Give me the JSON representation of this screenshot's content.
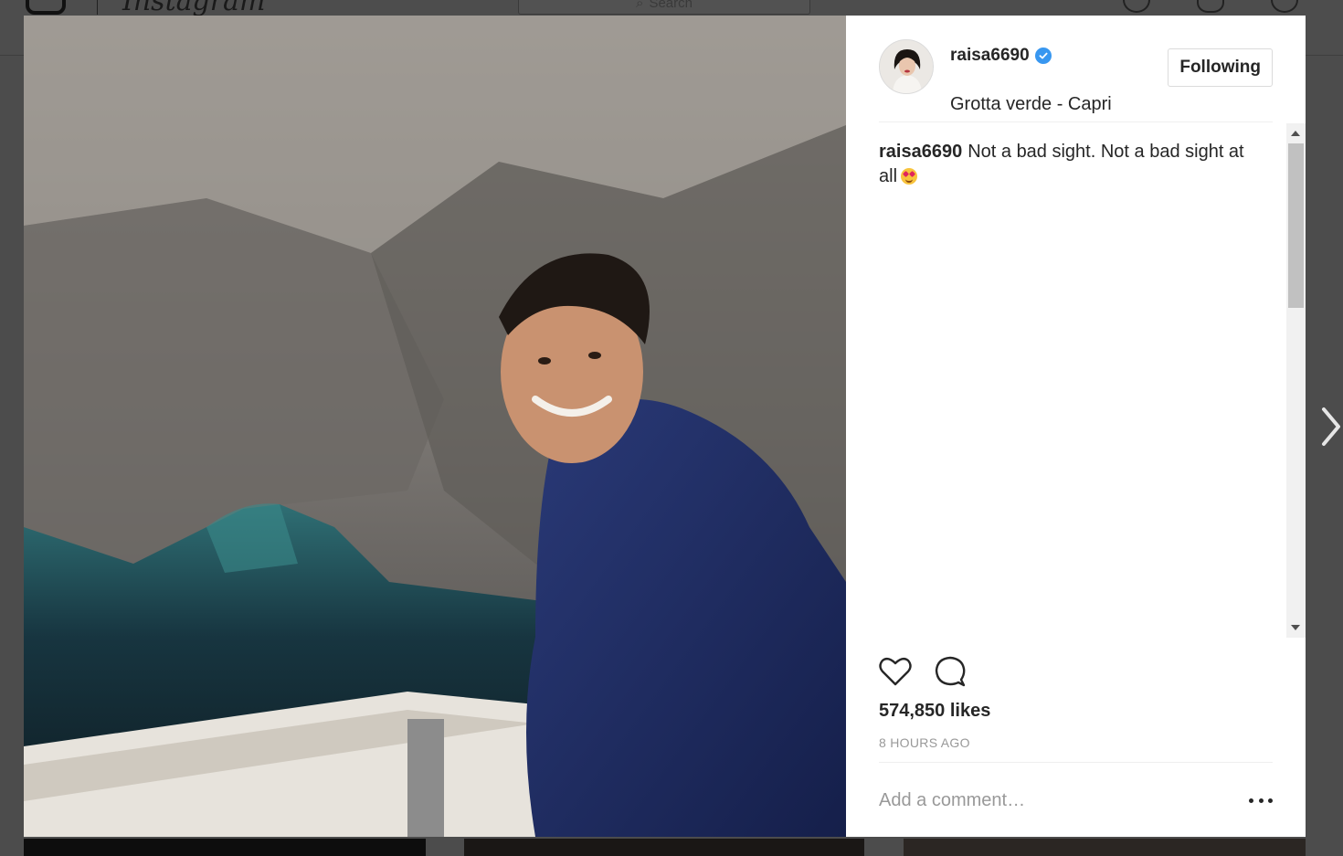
{
  "background": {
    "brand_wordmark": "Instagram",
    "search_placeholder": "Search"
  },
  "post": {
    "author": {
      "username": "raisa6690",
      "verified": true,
      "location": "Grotta verde - Capri",
      "follow_label": "Following"
    },
    "caption": {
      "username": "raisa6690",
      "text": "Not a bad sight. Not a bad sight at all",
      "emoji": "smiling-face-with-heart-eyes"
    },
    "likes": "574,850 likes",
    "timestamp": "8 HOURS AGO",
    "comment_placeholder": "Add a comment…"
  },
  "colors": {
    "verified_badge": "#3897f0",
    "text_primary": "#262626",
    "text_muted": "#999999",
    "overlay": "#4c4c4c"
  },
  "icons": {
    "like": "heart-outline-icon",
    "comment": "speech-bubble-icon",
    "more": "more-options-icon",
    "next": "chevron-right-icon"
  }
}
